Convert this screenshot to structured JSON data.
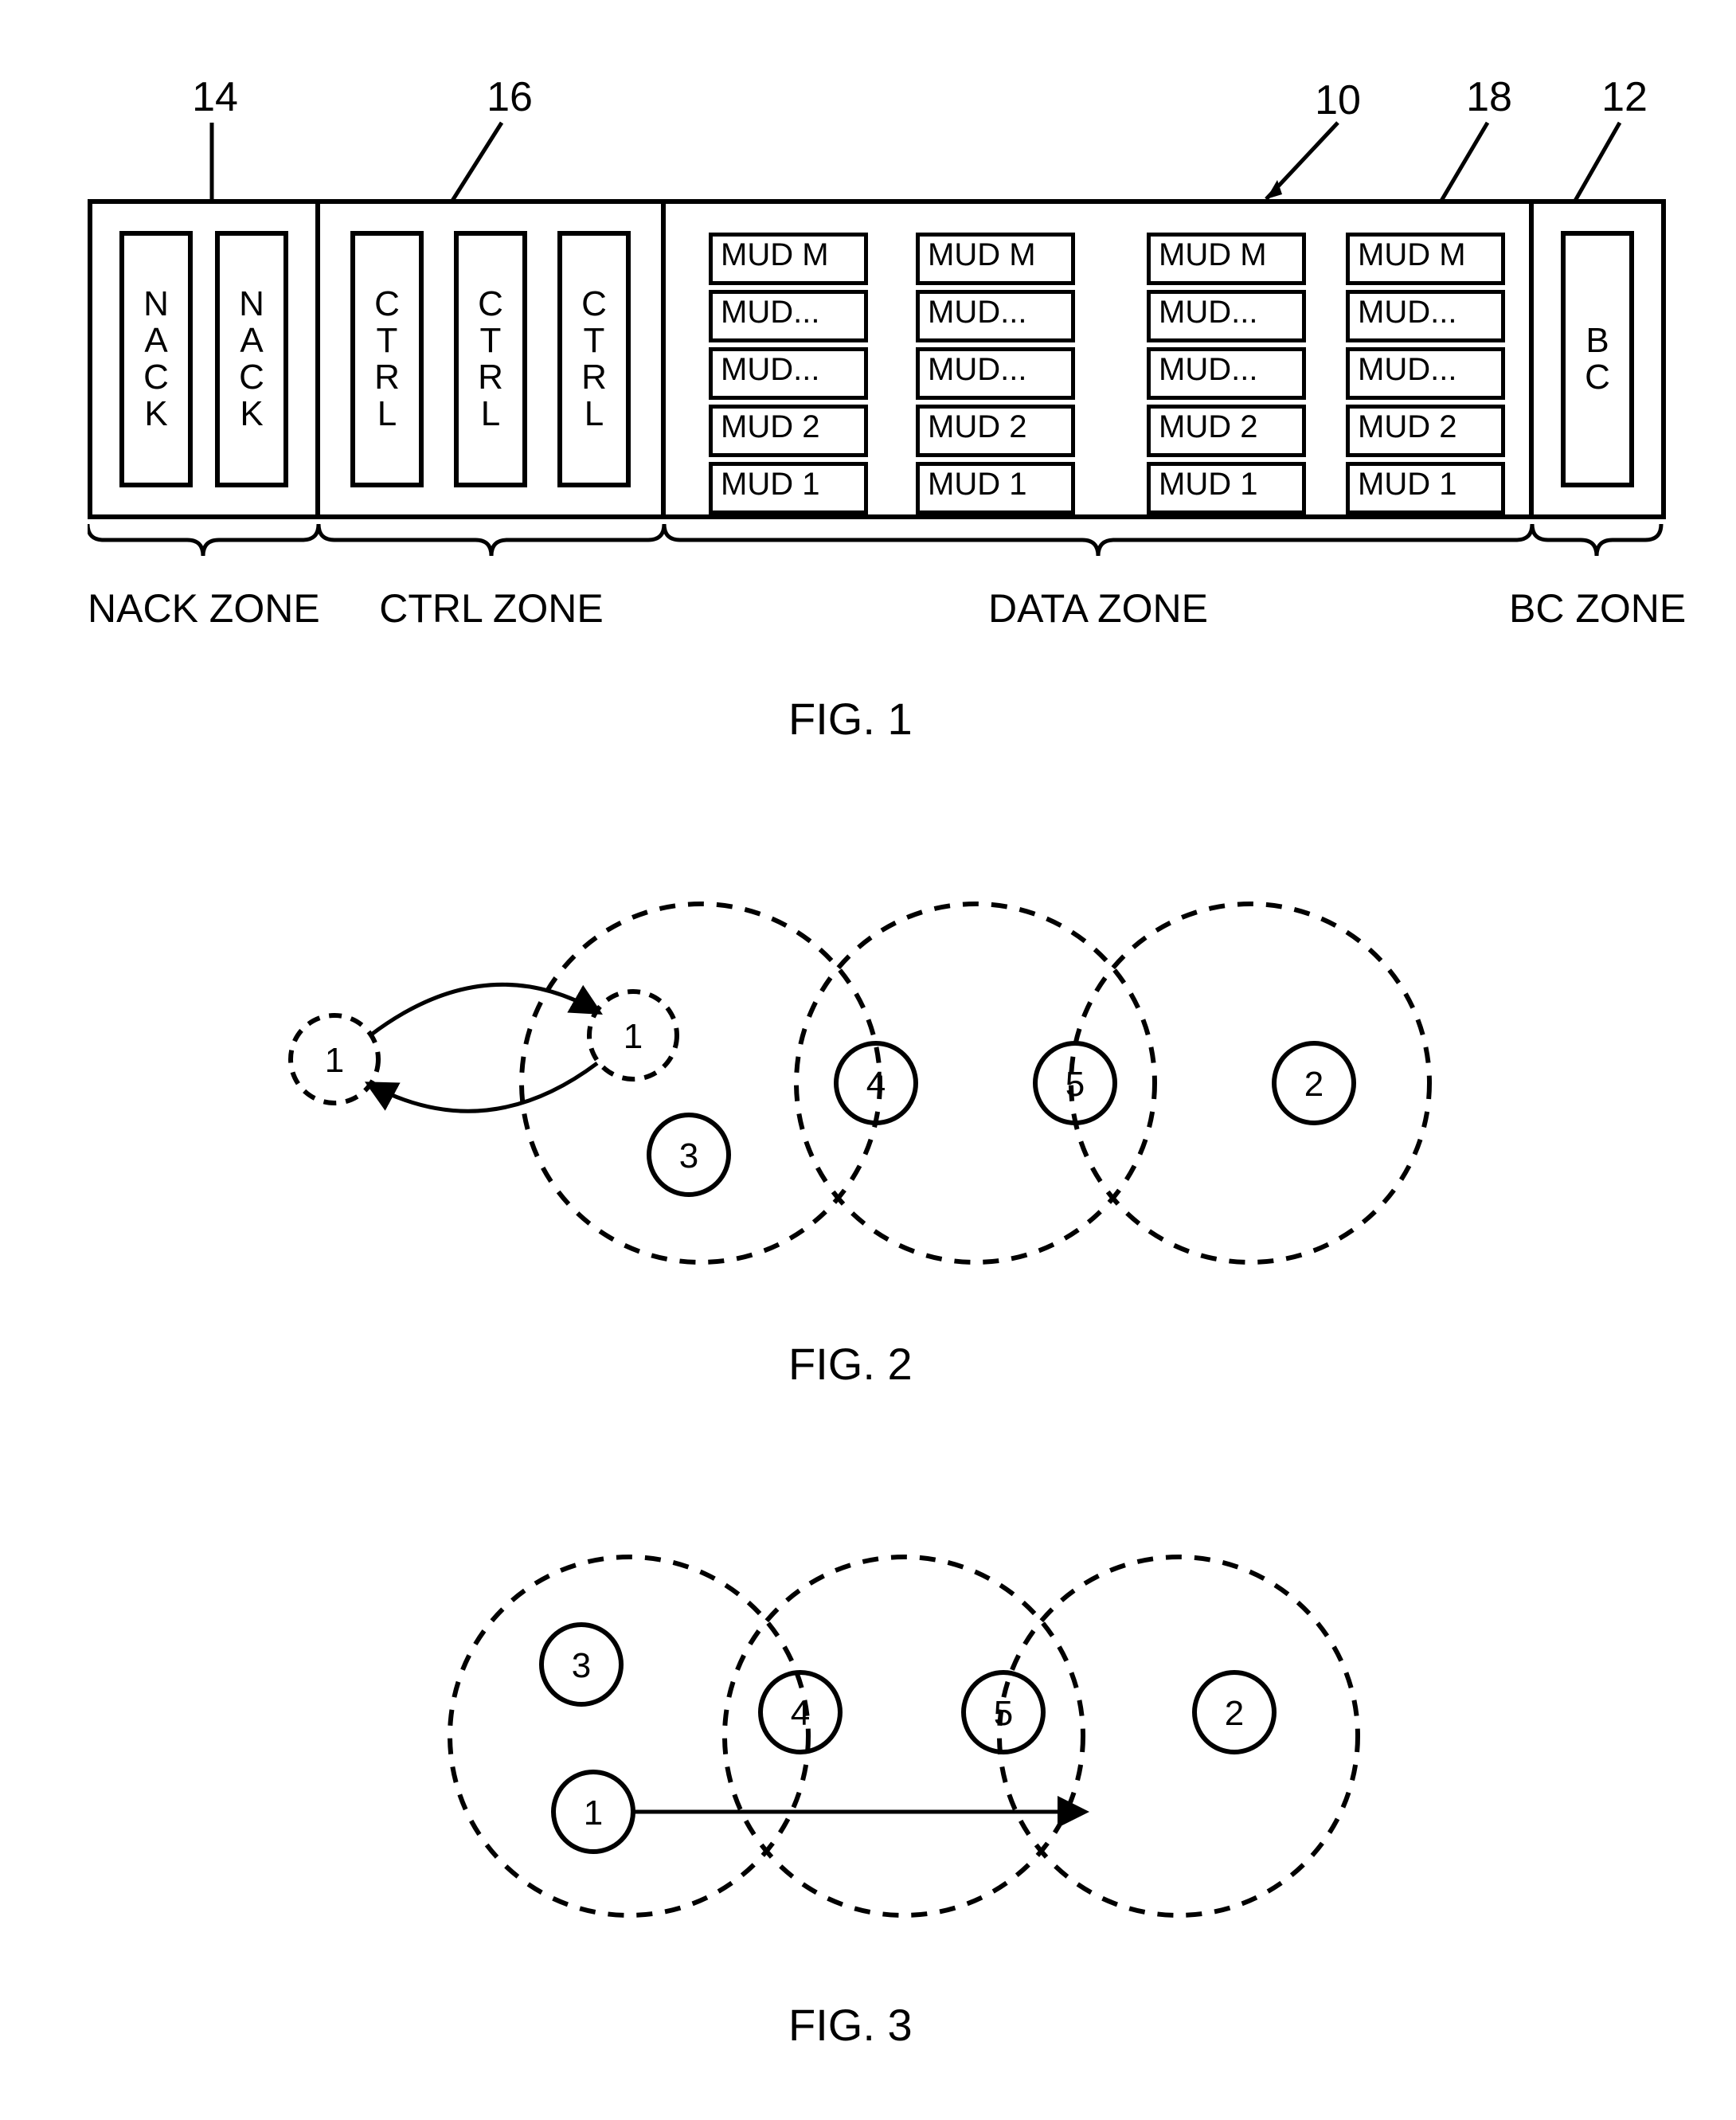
{
  "fig1": {
    "refs": {
      "r14": "14",
      "r16": "16",
      "r10": "10",
      "r18": "18",
      "r12": "12"
    },
    "nack_slot1": "N\nA\nC\nK",
    "nack_slot2": "N\nA\nC\nK",
    "ctrl_slot1": "C\nT\nR\nL",
    "ctrl_slot2": "C\nT\nR\nL",
    "ctrl_slot3": "C\nT\nR\nL",
    "mud_rows": [
      "MUD M",
      "MUD...",
      "MUD...",
      "MUD 2",
      "MUD 1"
    ],
    "bc_slot": "B\nC",
    "zone_nack": "NACK ZONE",
    "zone_ctrl": "CTRL ZONE",
    "zone_data": "DATA ZONE",
    "zone_bc": "BC ZONE",
    "caption": "FIG. 1"
  },
  "fig2": {
    "node_left1": "1",
    "node_right1": "1",
    "node3": "3",
    "node4": "4",
    "node5": "5",
    "node2": "2",
    "caption": "FIG. 2"
  },
  "fig3": {
    "node3": "3",
    "node1": "1",
    "node4": "4",
    "node5": "5",
    "node2": "2",
    "caption": "FIG. 3"
  }
}
